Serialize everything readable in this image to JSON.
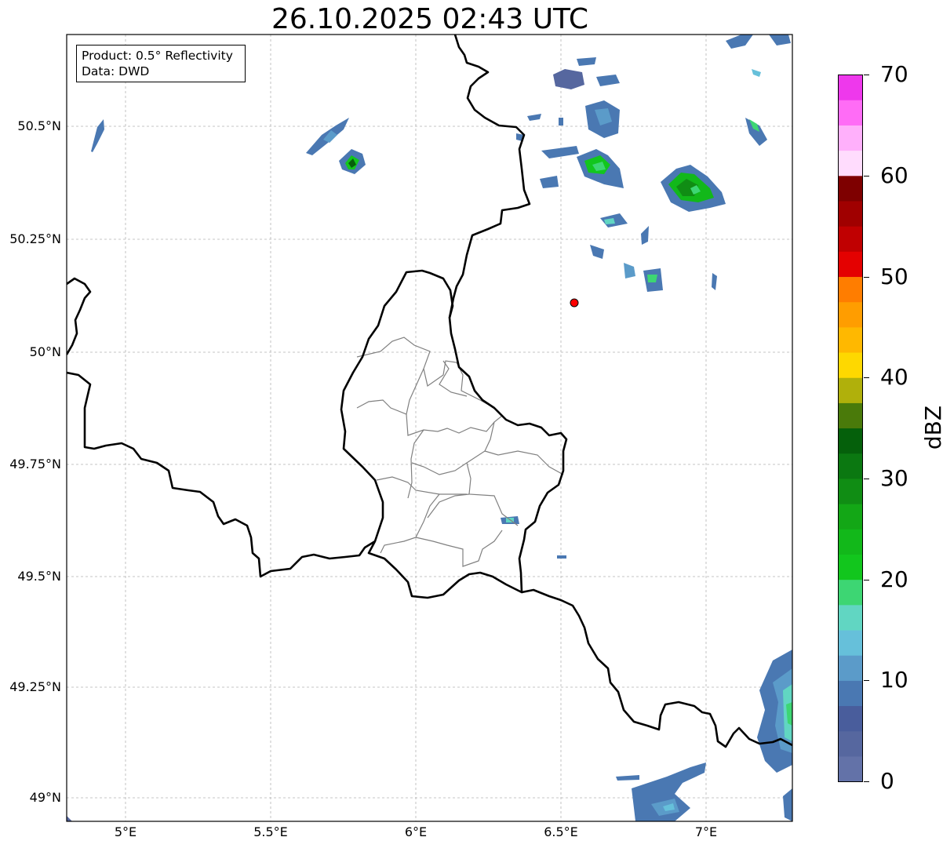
{
  "title": "26.10.2025 02:43 UTC",
  "infobox": {
    "product": "Product: 0.5° Reflectivity",
    "data": "Data: DWD"
  },
  "lat_labels": [
    "50.5°N",
    "50.25°N",
    "50°N",
    "49.75°N",
    "49.5°N",
    "49.25°N",
    "49°N"
  ],
  "lon_labels": [
    "5°E",
    "5.5°E",
    "6°E",
    "6.5°E",
    "7°E"
  ],
  "colorbar": {
    "unit": "dBZ",
    "tick_labels": [
      "0",
      "10",
      "20",
      "30",
      "40",
      "50",
      "60",
      "70"
    ],
    "colors": [
      "#6372a8",
      "#56679f",
      "#495d9c",
      "#4a78b2",
      "#5b9bc9",
      "#66c0da",
      "#61d6c2",
      "#3dd673",
      "#12c61d",
      "#12b81a",
      "#13a716",
      "#108d14",
      "#0b7811",
      "#05600b",
      "#4a7a0a",
      "#b0b00b",
      "#fed800",
      "#ffb800",
      "#ff9d00",
      "#ff7d00",
      "#e40101",
      "#c00001",
      "#a00000",
      "#7e0000",
      "#ffdcfd",
      "#ffb0fb",
      "#ff6cf6",
      "#ee38ec"
    ]
  },
  "radar_site_color": "#ff0000",
  "borders": {
    "country_color": "#000000",
    "district_color": "#808080"
  }
}
